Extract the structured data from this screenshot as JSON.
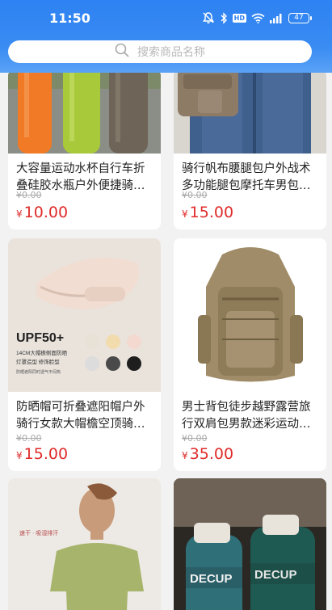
{
  "status_bar": {
    "time": "11:50",
    "battery": "47",
    "network_badge": "HD"
  },
  "search": {
    "placeholder": "搜索商品名称"
  },
  "products": [
    {
      "title": "大容量运动水杯自行车折叠硅胶水瓶户外便捷骑行水壶",
      "original_price": "¥0.00",
      "currency": "¥",
      "price": "10.00"
    },
    {
      "title": "骑行帆布腰腿包户外战术多功能腿包摩托车男包腰包",
      "original_price": "¥0.00",
      "currency": "¥",
      "price": "15.00"
    },
    {
      "title": "防晒帽可折叠遮阳帽户外骑行女款大帽檐空顶骑行帽",
      "original_price": "¥0.00",
      "currency": "¥",
      "price": "15.00",
      "image_text": {
        "headline": "UPF50+",
        "line1": "14CM大帽檐侧面防晒",
        "line2": "灯罩造型 修饰脸型",
        "line3": "防晒遮阳同时透气不闷热"
      }
    },
    {
      "title": "男士背包徒步越野露营旅行双肩包男款迷彩运动背包",
      "original_price": "¥0.00",
      "currency": "¥",
      "price": "35.00"
    },
    {
      "title": "",
      "image_text": {
        "line1": "速干 · 吸湿排汗"
      }
    },
    {
      "title": "",
      "image_text": {
        "brand": "DECUP"
      }
    }
  ],
  "colors": {
    "header": "#2e82f2",
    "price": "#e02b2b",
    "background": "#f2f2f2"
  }
}
